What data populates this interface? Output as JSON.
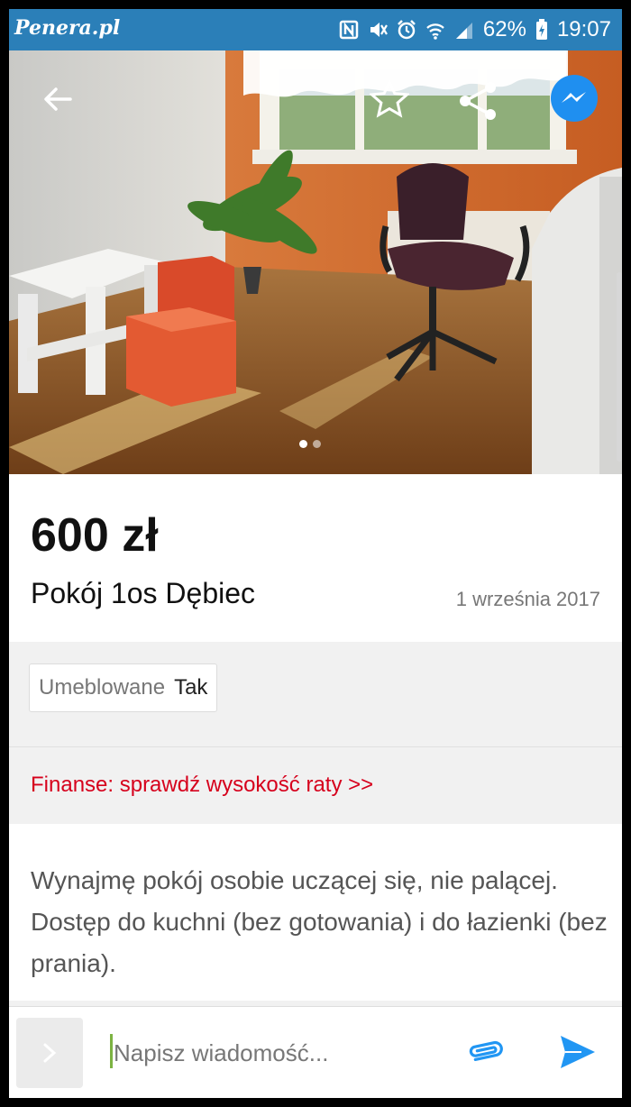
{
  "status_bar": {
    "watermark": "Penera.pl",
    "battery": "62%",
    "time": "19:07",
    "icons": [
      "nfc-icon",
      "mute-icon",
      "alarm-icon",
      "wifi-icon",
      "signal-icon",
      "battery-icon"
    ]
  },
  "gallery": {
    "image_count": 2,
    "active_index": 0,
    "actions": [
      "back-arrow-icon",
      "star-icon",
      "share-icon",
      "messenger-icon"
    ]
  },
  "listing": {
    "price": "600 zł",
    "title": "Pokój 1os Dębiec",
    "date": "1 września 2017"
  },
  "attributes": [
    {
      "key": "Umeblowane",
      "value": "Tak"
    }
  ],
  "finance": {
    "link_text": "Finanse: sprawdź wysokość raty >>"
  },
  "description": {
    "text": "Wynajmę pokój osobie uczącej się, nie palącej. Dostęp do kuchni (bez gotowania) i do łazienki (bez prania)."
  },
  "composer": {
    "placeholder": "Napisz wiadomość...",
    "expand_icon": "chevron-right-icon",
    "attach_icon": "paperclip-icon",
    "send_icon": "send-icon"
  },
  "colors": {
    "status_bar": "#2b7fb8",
    "finance_link": "#d6001c",
    "accent_blue": "#2196f3",
    "caret": "#7cb342"
  }
}
